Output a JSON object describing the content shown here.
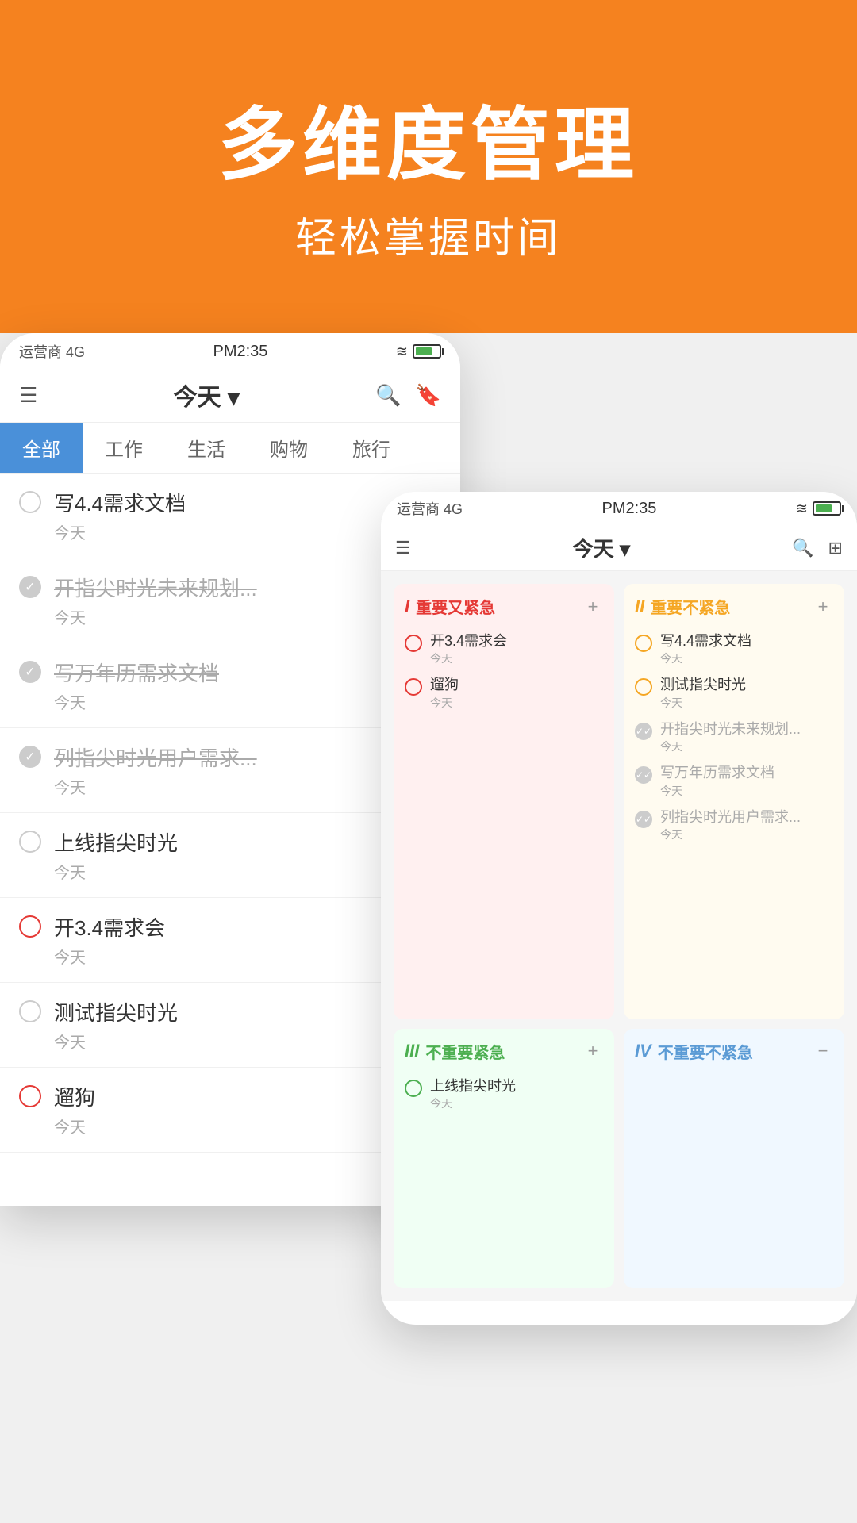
{
  "banner": {
    "title": "多维度管理",
    "subtitle": "轻松掌握时间"
  },
  "back_phone": {
    "status": {
      "carrier": "运营商 4G",
      "time": "PM2:35"
    },
    "nav": {
      "title": "今天",
      "title_arrow": "▾"
    },
    "tabs": [
      "全部",
      "工作",
      "生活",
      "购物",
      "旅行"
    ],
    "active_tab": "全部",
    "tasks": [
      {
        "title": "写4.4需求文档",
        "date": "今天",
        "done": false,
        "urgent": false
      },
      {
        "title": "开指尖时光未来规划...",
        "date": "今天",
        "done": true,
        "urgent": false
      },
      {
        "title": "写万年历需求文档",
        "date": "今天",
        "done": true,
        "urgent": false
      },
      {
        "title": "列指尖时光用户需求...",
        "date": "今天",
        "done": true,
        "urgent": false
      },
      {
        "title": "上线指尖时光",
        "date": "今天",
        "done": false,
        "urgent": false
      },
      {
        "title": "开3.4需求会",
        "date": "今天",
        "done": false,
        "urgent": true
      },
      {
        "title": "测试指尖时光",
        "date": "今天",
        "done": false,
        "urgent": false
      },
      {
        "title": "遛狗",
        "date": "今天",
        "done": false,
        "urgent": true
      }
    ]
  },
  "front_phone": {
    "status": {
      "carrier": "运营商 4G",
      "time": "PM2:35"
    },
    "nav": {
      "title": "今天",
      "title_arrow": "▾"
    },
    "quadrants": [
      {
        "id": "q1",
        "num": "I",
        "label": "重要又紧急",
        "tasks": [
          {
            "title": "开3.4需求会",
            "date": "今天",
            "done": false
          },
          {
            "title": "遛狗",
            "date": "今天",
            "done": false
          }
        ]
      },
      {
        "id": "q2",
        "num": "II",
        "label": "重要不紧急",
        "tasks": [
          {
            "title": "写4.4需求文档",
            "date": "今天",
            "done": false
          },
          {
            "title": "测试指尖时光",
            "date": "今天",
            "done": false
          },
          {
            "title": "开指尖时光未来规划...",
            "date": "今天",
            "done": true
          },
          {
            "title": "写万年历需求文档",
            "date": "今天",
            "done": true
          },
          {
            "title": "列指尖时光用户需求...",
            "date": "今天",
            "done": true
          }
        ]
      },
      {
        "id": "q3",
        "num": "III",
        "label": "不重要紧急",
        "tasks": [
          {
            "title": "上线指尖时光",
            "date": "今天",
            "done": false
          }
        ]
      },
      {
        "id": "q4",
        "num": "IV",
        "label": "不重要不紧急",
        "tasks": []
      }
    ]
  },
  "icons": {
    "hamburger": "☰",
    "search": "🔍",
    "bookmark": "🔖",
    "grid": "⊞",
    "plus": "+"
  }
}
